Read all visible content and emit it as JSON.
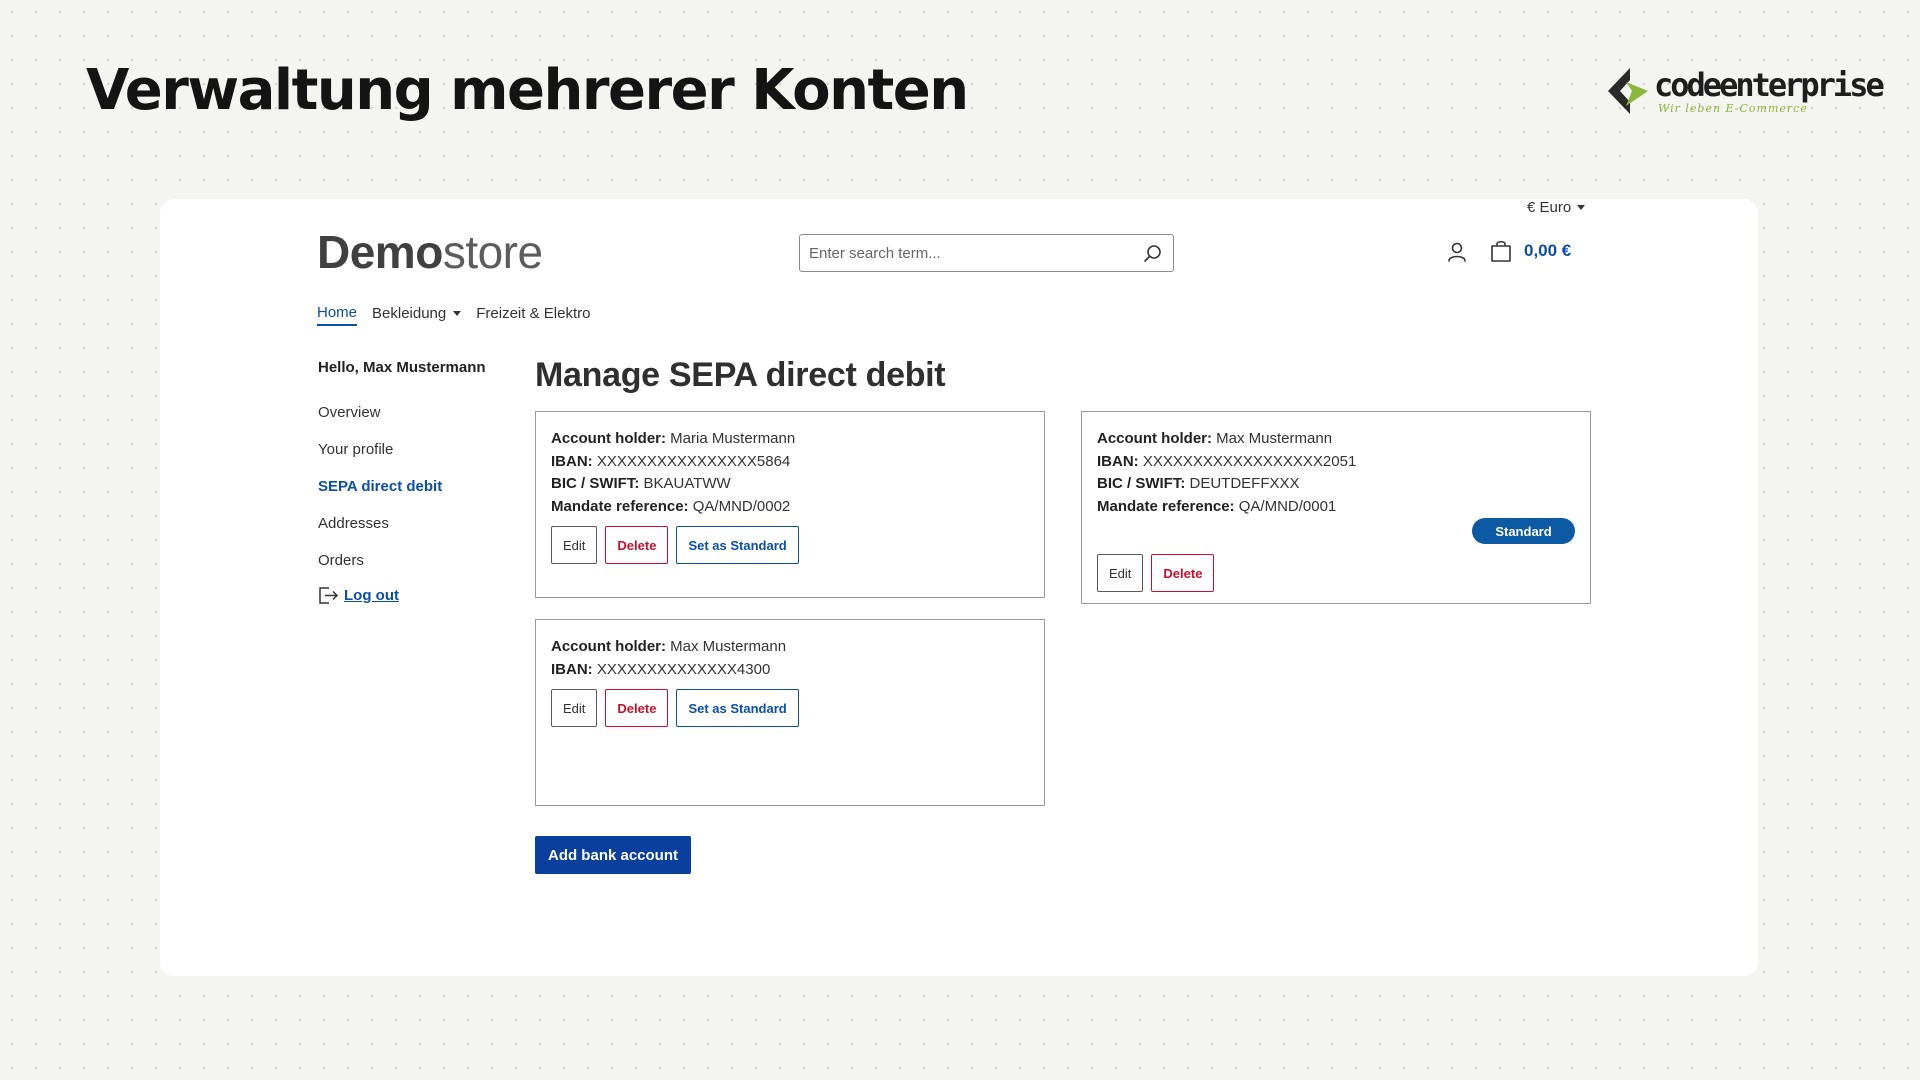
{
  "slide": {
    "title": "Verwaltung mehrerer Konten",
    "brand_name": "codeenterprise",
    "brand_tagline": "Wir leben E-Commerce"
  },
  "header": {
    "currency_label": "€ Euro",
    "logo_bold": "Demo",
    "logo_light": "store",
    "search_placeholder": "Enter search term...",
    "cart_total": "0,00 €"
  },
  "nav": {
    "items": [
      {
        "label": "Home"
      },
      {
        "label": "Bekleidung"
      },
      {
        "label": "Freizeit & Elektro"
      }
    ]
  },
  "sidebar": {
    "greeting": "Hello, Max Mustermann",
    "items": [
      {
        "label": "Overview"
      },
      {
        "label": "Your profile"
      },
      {
        "label": "SEPA direct debit"
      },
      {
        "label": "Addresses"
      },
      {
        "label": "Orders"
      }
    ],
    "logout_label": "Log out"
  },
  "main": {
    "title": "Manage SEPA direct debit",
    "labels": {
      "holder": "Account holder:",
      "iban": "IBAN:",
      "bic": "BIC / SWIFT:",
      "mandate": "Mandate reference:"
    },
    "buttons": {
      "edit": "Edit",
      "delete": "Delete",
      "set_standard": "Set as Standard"
    },
    "standard_badge": "Standard",
    "accounts": [
      {
        "holder": "Maria Mustermann",
        "iban": "XXXXXXXXXXXXXXXX5864",
        "bic": "BKAUATWW",
        "mandate": "QA/MND/0002"
      },
      {
        "holder": "Max Mustermann",
        "iban": "XXXXXXXXXXXXXXXXXX2051",
        "bic": "DEUTDEFFXXX",
        "mandate": "QA/MND/0001"
      },
      {
        "holder": "Max Mustermann",
        "iban": "XXXXXXXXXXXXXX4300"
      }
    ],
    "add_button": "Add bank account"
  },
  "colors": {
    "accent": "#0b4fa8",
    "danger": "#c8102e",
    "primary_button": "#0a3f9e",
    "brand_green": "#8cb63c"
  }
}
